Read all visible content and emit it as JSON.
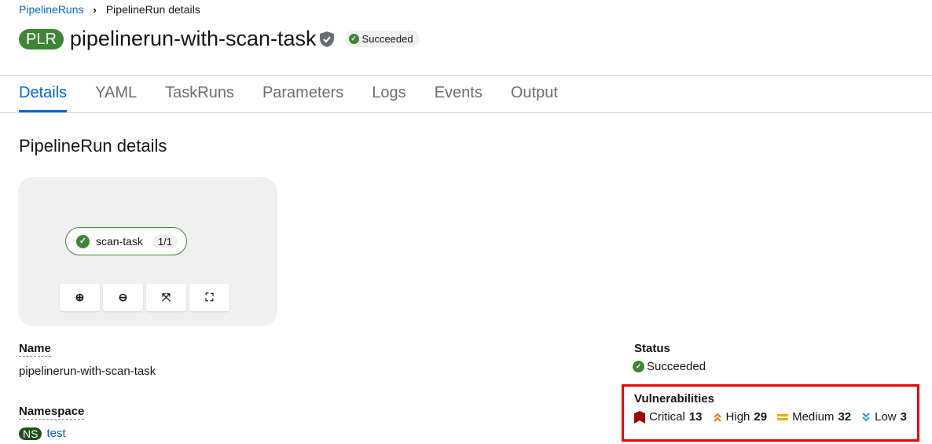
{
  "breadcrumb": {
    "parent": "PipelineRuns",
    "current": "PipelineRun details"
  },
  "header": {
    "badge": "PLR",
    "title": "pipelinerun-with-scan-task",
    "status": "Succeeded"
  },
  "tabs": [
    "Details",
    "YAML",
    "TaskRuns",
    "Parameters",
    "Logs",
    "Events",
    "Output"
  ],
  "section_title": "PipelineRun details",
  "topology": {
    "node_name": "scan-task",
    "node_count": "1/1"
  },
  "details": {
    "name_label": "Name",
    "name_value": "pipelinerun-with-scan-task",
    "namespace_label": "Namespace",
    "namespace_badge": "NS",
    "namespace_value": "test",
    "status_label": "Status",
    "status_value": "Succeeded",
    "vuln_label": "Vulnerabilities",
    "vulns": [
      {
        "label": "Critical",
        "count": "13",
        "color": "#a30000"
      },
      {
        "label": "High",
        "count": "29",
        "color": "#ec7a08"
      },
      {
        "label": "Medium",
        "count": "32",
        "color": "#f0ab00"
      },
      {
        "label": "Low",
        "count": "3",
        "color": "#2b9af3"
      }
    ]
  }
}
